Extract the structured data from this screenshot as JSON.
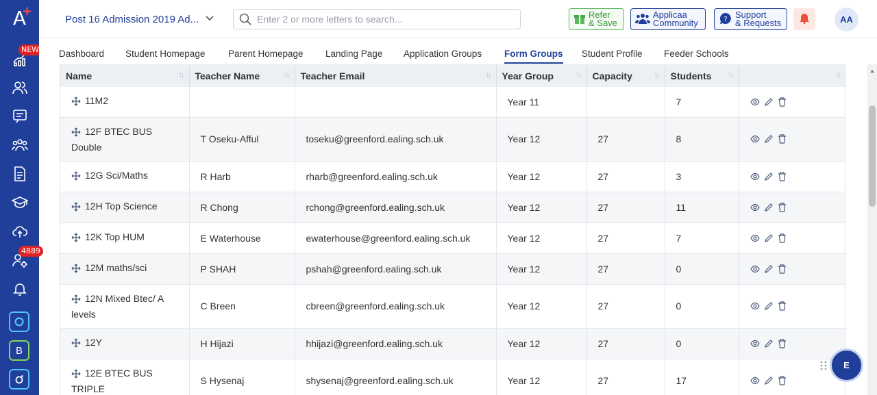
{
  "sidebar": {
    "logo": "A",
    "new_badge": "NEW",
    "users_badge": "4889",
    "apps": [
      "B"
    ]
  },
  "header": {
    "admission_select": "Post 16 Admission 2019 Ad...",
    "search_placeholder": "Enter 2 or more letters to search...",
    "refer_line1": "Refer",
    "refer_line2": "& Save",
    "community_line1": "Applicaa",
    "community_line2": "Community",
    "support_line1": "Support",
    "support_line2": "& Requests",
    "avatar": "AA"
  },
  "tabs": [
    "Dashboard",
    "Student Homepage",
    "Parent Homepage",
    "Landing Page",
    "Application Groups",
    "Form Groups",
    "Student Profile",
    "Feeder Schools"
  ],
  "table": {
    "columns": [
      "Name",
      "Teacher Name",
      "Teacher Email",
      "Year Group",
      "Capacity",
      "Students",
      ""
    ],
    "rows": [
      {
        "name": "11M2",
        "teacher": "",
        "email": "",
        "year": "Year 11",
        "capacity": "",
        "students": "7"
      },
      {
        "name": "12F BTEC BUS Double",
        "teacher": "T Oseku-Afful",
        "email": "toseku@greenford.ealing.sch.uk",
        "year": "Year 12",
        "capacity": "27",
        "students": "8"
      },
      {
        "name": "12G Sci/Maths",
        "teacher": "R Harb",
        "email": "rharb@greenford.ealing.sch.uk",
        "year": "Year 12",
        "capacity": "27",
        "students": "3"
      },
      {
        "name": "12H Top Science",
        "teacher": "R Chong",
        "email": "rchong@greenford.ealing.sch.uk",
        "year": "Year 12",
        "capacity": "27",
        "students": "11"
      },
      {
        "name": "12K Top HUM",
        "teacher": "E Waterhouse",
        "email": "ewaterhouse@greenford.ealing.sch.uk",
        "year": "Year 12",
        "capacity": "27",
        "students": "7"
      },
      {
        "name": "12M maths/sci",
        "teacher": "P SHAH",
        "email": "pshah@greenford.ealing.sch.uk",
        "year": "Year 12",
        "capacity": "27",
        "students": "0"
      },
      {
        "name": "12N Mixed Btec/ A levels",
        "teacher": "C Breen",
        "email": "cbreen@greenford.ealing.sch.uk",
        "year": "Year 12",
        "capacity": "27",
        "students": "0"
      },
      {
        "name": "12Y",
        "teacher": "H Hijazi",
        "email": "hhijazi@greenford.ealing.sch.uk",
        "year": "Year 12",
        "capacity": "27",
        "students": "0"
      },
      {
        "name": "12E BTEC BUS TRIPLE",
        "teacher": "S Hysenaj",
        "email": "shysenaj@greenford.ealing.sch.uk",
        "year": "Year 12",
        "capacity": "27",
        "students": "17"
      }
    ]
  },
  "chat": {
    "label": "E"
  },
  "colors": {
    "brand": "#1f3f9a",
    "accent_red": "#e02424",
    "refer_green": "#3c9a3c"
  }
}
